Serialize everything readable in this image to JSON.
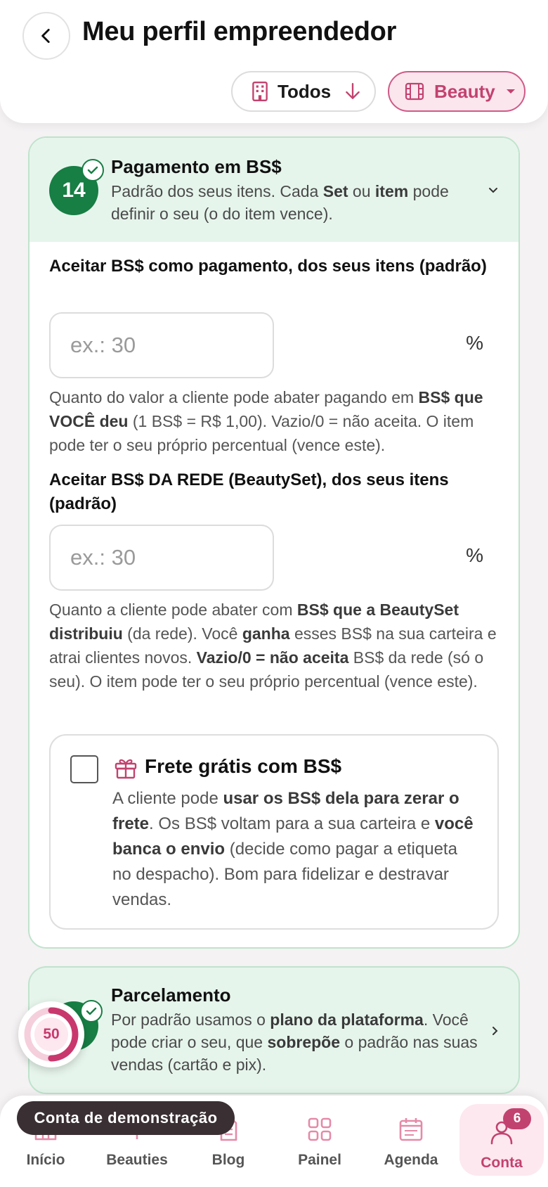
{
  "header": {
    "title": "Meu perfil empreendedor",
    "filter_all": "Todos",
    "filter_segment": "Beauty"
  },
  "bs_payment": {
    "step_number": "14",
    "title": "Pagamento em BS$",
    "desc_pre": "Padrão dos seus itens. Cada ",
    "desc_b1": "Set",
    "desc_mid": " ou ",
    "desc_b2": "item",
    "desc_post": " pode definir o seu (o do item vence).",
    "own": {
      "label": "Aceitar BS$ como pagamento, dos seus itens (padrão)",
      "placeholder": "ex.: 30",
      "value": "",
      "unit": "%",
      "help_1": "Quanto do valor a cliente pode abater pagando em ",
      "help_b1": "BS$ que VOCÊ deu",
      "help_2": " (1 BS$ = R$ 1,00). Vazio/0 = não aceita. O item pode ter o seu próprio percentual (vence este)."
    },
    "network": {
      "label": "Aceitar BS$ DA REDE (BeautySet), dos seus itens (padrão)",
      "placeholder": "ex.: 30",
      "value": "",
      "unit": "%",
      "help_1": "Quanto a cliente pode abater com ",
      "help_b1": "BS$ que a BeautySet distribuiu",
      "help_2": " (da rede). Você ",
      "help_b2": "ganha",
      "help_3": " esses BS$ na sua carteira e atrai clientes novos. ",
      "help_b3": "Vazio/0 = não aceita",
      "help_4": " BS$ da rede (só o seu). O item pode ter o seu próprio percentual (vence este)."
    },
    "free_shipping": {
      "title": "Frete grátis com BS$",
      "checked": false,
      "d1": "A cliente pode ",
      "b1": "usar os BS$ dela para zerar o frete",
      "d2": ". Os BS$ voltam para a sua carteira e ",
      "b2": "você banca o envio",
      "d3": " (decide como pagar a etiqueta no despacho). Bom para fidelizar e destravar vendas."
    }
  },
  "installments": {
    "title": "Parcelamento",
    "d1": "Por padrão usamos o ",
    "b1": "plano da plataforma",
    "d2": ". Você pode criar o seu, que ",
    "b2": "sobrepõe",
    "d3": " o padrão nas suas vendas (cartão e pix)."
  },
  "score": {
    "value": "50",
    "progress": 0.5
  },
  "demo_label": "Conta de demonstração",
  "nav": {
    "home": "Início",
    "beauties": "Beauties",
    "blog": "Blog",
    "panel": "Painel",
    "agenda": "Agenda",
    "account": "Conta",
    "account_badge": "6"
  },
  "colors": {
    "brand": "#c2426f",
    "success": "#177e44",
    "success_bg": "#e6f5ec"
  }
}
